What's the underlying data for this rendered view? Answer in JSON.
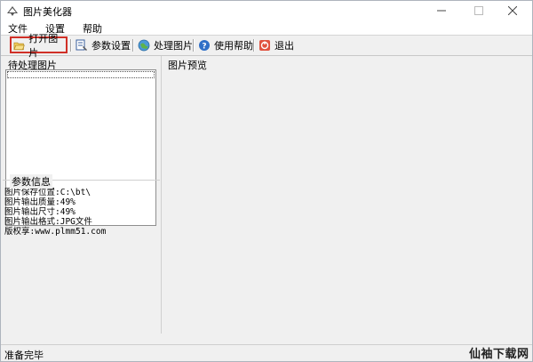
{
  "window": {
    "title": "图片美化器"
  },
  "menu": {
    "items": [
      "文件",
      "设置",
      "帮助"
    ]
  },
  "toolbar": {
    "open_label": "打开图片",
    "params_label": "参数设置",
    "process_label": "处理图片",
    "help_label": "使用帮助",
    "exit_label": "退出"
  },
  "left": {
    "pending_label": "待处理图片",
    "params_title": "参数信息",
    "params_lines": [
      "图片保存位置:C:\\bt\\",
      "图片输出质量:49%",
      "图片输出尺寸:49%",
      "图片输出格式:JPG文件",
      "版权享:www.plmm51.com"
    ]
  },
  "preview": {
    "label": "图片预览"
  },
  "status": {
    "text": "准备完毕"
  },
  "watermark": "仙袖下载网",
  "colors": {
    "highlight": "#d03027",
    "window_bg": "#f0f0f0"
  }
}
